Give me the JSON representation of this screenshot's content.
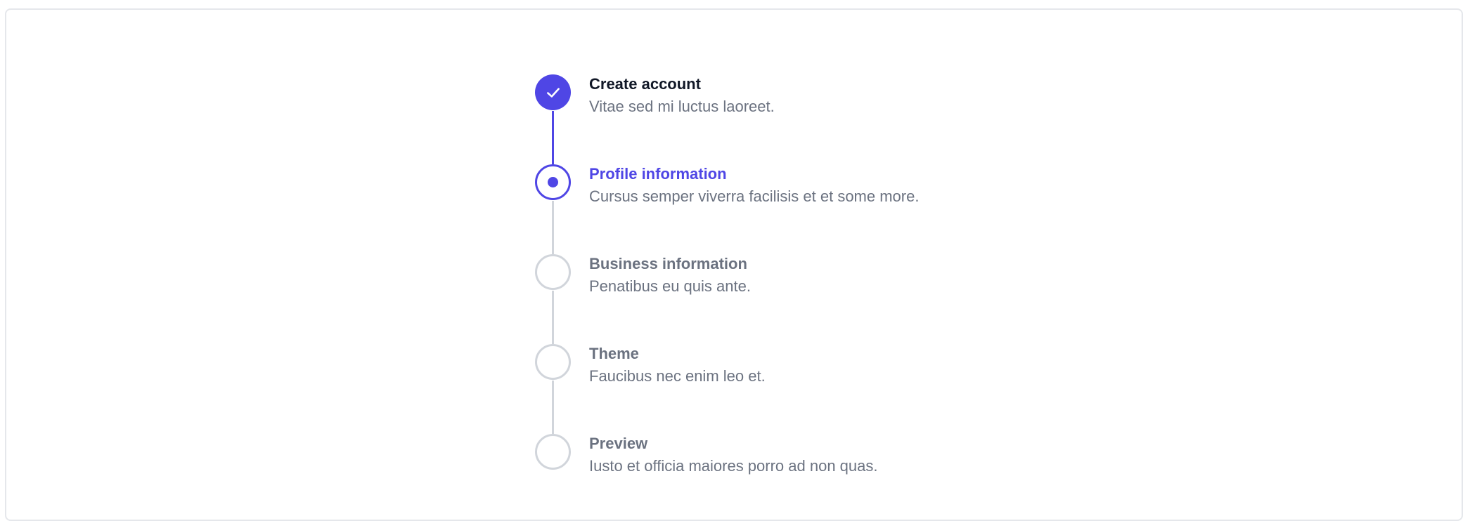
{
  "colors": {
    "accent": "#4f46e5",
    "inactive_border": "#d1d5db",
    "title_default": "#111827",
    "muted_text": "#6b7280"
  },
  "steps": [
    {
      "title": "Create account",
      "description": "Vitae sed mi luctus laoreet.",
      "status": "complete",
      "icon": "check-icon"
    },
    {
      "title": "Profile information",
      "description": "Cursus semper viverra facilisis et et some more.",
      "status": "current",
      "icon": "current-dot-icon"
    },
    {
      "title": "Business information",
      "description": "Penatibus eu quis ante.",
      "status": "upcoming",
      "icon": "empty-circle-icon"
    },
    {
      "title": "Theme",
      "description": "Faucibus nec enim leo et.",
      "status": "upcoming",
      "icon": "empty-circle-icon"
    },
    {
      "title": "Preview",
      "description": "Iusto et officia maiores porro ad non quas.",
      "status": "upcoming",
      "icon": "empty-circle-icon"
    }
  ]
}
